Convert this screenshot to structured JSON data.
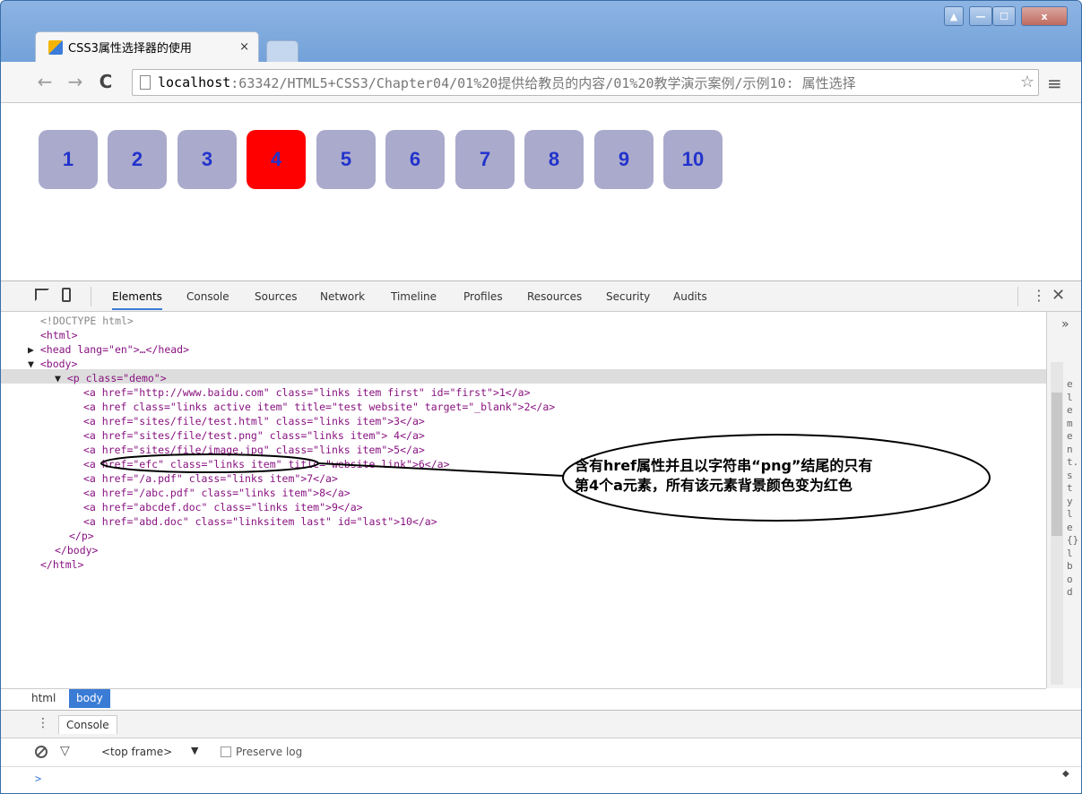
{
  "tab": {
    "title": "CSS3属性选择器的使用",
    "close": "×"
  },
  "window_controls": {
    "user": "▲",
    "minimize": "—",
    "maximize": "☐",
    "close": "x"
  },
  "toolbar": {
    "back": "←",
    "forward": "→",
    "reload": "C",
    "menu": "≡",
    "star": "☆"
  },
  "url": {
    "host": "localhost",
    "path": ":63342/HTML5+CSS3/Chapter04/01%20提供给教员的内容/01%20教学演示案例/示例10: 属性选择"
  },
  "page_buttons": [
    "1",
    "2",
    "3",
    "4",
    "5",
    "6",
    "7",
    "8",
    "9",
    "10"
  ],
  "highlighted_button": "4",
  "colors": {
    "button_bg": "#aaaacc",
    "button_text": "#2233cc",
    "highlight_bg": "#ff0000",
    "devtools_accent": "#3a7bd5"
  },
  "devtools": {
    "tabs": [
      "Elements",
      "Console",
      "Sources",
      "Network",
      "Timeline",
      "Profiles",
      "Resources",
      "Security",
      "Audits"
    ],
    "active_tab": "Elements",
    "code": {
      "doctype": "<!DOCTYPE html>",
      "html_open": "<html>",
      "head": "<head lang=\"en\">…</head>",
      "body_open": "<body>",
      "p_open": "<p class=\"demo\">",
      "rows": [
        "<a href=\"http://www.baidu.com\" class=\"links item first\" id=\"first\">1</a>",
        "<a href class=\"links active item\" title=\"test website\" target=\"_blank\">2</a>",
        "<a href=\"sites/file/test.html\" class=\"links item\">3</a>",
        "<a href=\"sites/file/test.png\" class=\"links item\"> 4</a>",
        "<a href=\"sites/file/image.jpg\" class=\"links item\">5</a>",
        "<a href=\"efc\" class=\"links item\" title=\"website link\">6</a>",
        "<a href=\"/a.pdf\" class=\"links item\">7</a>",
        "<a href=\"/abc.pdf\" class=\"links item\">8</a>",
        "<a href=\"abcdef.doc\" class=\"links item\">9</a>",
        "<a href=\"abd.doc\" class=\"linksitem last\" id=\"last\">10</a>"
      ],
      "p_close": "</p>",
      "body_close": "</body>",
      "html_close": "</html>"
    },
    "side_letters": "element.style{}lbod",
    "side_arrow": "»",
    "breadcrumbs": [
      "html",
      "body"
    ],
    "drawer_tab": "Console",
    "frame": "<top frame>",
    "preserve_log": "Preserve log",
    "more": "⋮",
    "close": "✕",
    "prompt": ">"
  },
  "annotation": {
    "line1": "含有href属性并且以字符串“png”结尾的只有",
    "line2": "第4个a元素，所有该元素背景颜色变为红色"
  }
}
